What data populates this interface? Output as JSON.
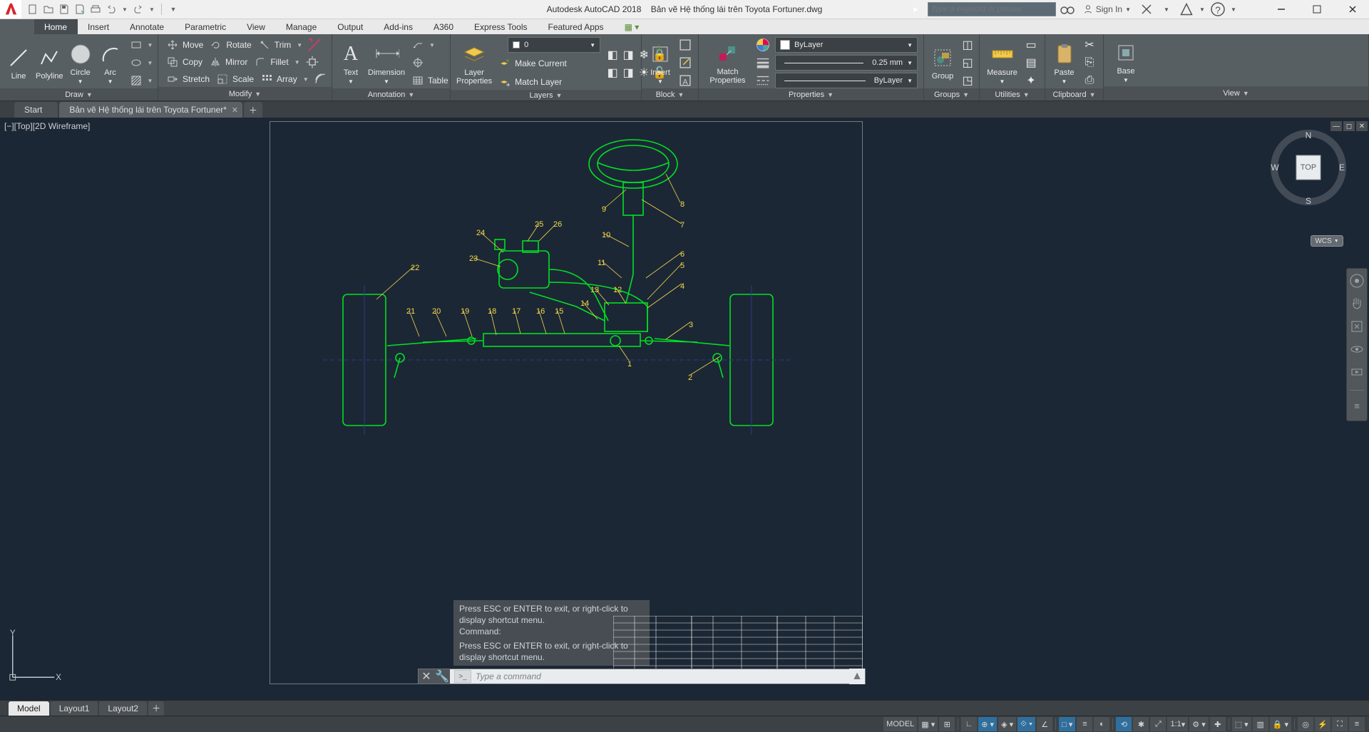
{
  "app": {
    "name": "Autodesk AutoCAD 2018",
    "document": "Bản vẽ Hệ thống lái trên Toyota Fortuner.dwg"
  },
  "search": {
    "placeholder": "Type a keyword or phrase"
  },
  "signin": {
    "label": "Sign In"
  },
  "ribbon_tabs": [
    "Home",
    "Insert",
    "Annotate",
    "Parametric",
    "View",
    "Manage",
    "Output",
    "Add-ins",
    "A360",
    "Express Tools",
    "Featured Apps"
  ],
  "ribbon_active_tab": "Home",
  "panels": {
    "draw": {
      "title": "Draw",
      "tools": {
        "line": "Line",
        "polyline": "Polyline",
        "circle": "Circle",
        "arc": "Arc"
      }
    },
    "modify": {
      "title": "Modify",
      "tools": {
        "move": "Move",
        "rotate": "Rotate",
        "trim": "Trim",
        "copy": "Copy",
        "mirror": "Mirror",
        "fillet": "Fillet",
        "stretch": "Stretch",
        "scale": "Scale",
        "array": "Array"
      }
    },
    "annotation": {
      "title": "Annotation",
      "tools": {
        "text": "Text",
        "dimension": "Dimension",
        "table": "Table"
      }
    },
    "layers": {
      "title": "Layers",
      "tools": {
        "layerprops": "Layer\nProperties",
        "makecurrent": "Make Current",
        "matchlayer": "Match Layer"
      },
      "current_layer": "0"
    },
    "block": {
      "title": "Block",
      "tools": {
        "insert": "Insert"
      }
    },
    "properties": {
      "title": "Properties",
      "tools": {
        "matchprops": "Match\nProperties"
      },
      "color": "ByLayer",
      "lineweight": "0.25 mm",
      "linetype": "ByLayer"
    },
    "groups": {
      "title": "Groups",
      "tools": {
        "group": "Group"
      }
    },
    "utilities": {
      "title": "Utilities",
      "tools": {
        "measure": "Measure"
      }
    },
    "clipboard": {
      "title": "Clipboard",
      "tools": {
        "paste": "Paste"
      }
    },
    "view": {
      "title": "View",
      "tools": {
        "base": "Base"
      }
    }
  },
  "file_tabs": {
    "start": "Start",
    "doc": "Bản vẽ Hệ thống lái trên Toyota Fortuner*"
  },
  "viewport_label": "[−][Top][2D Wireframe]",
  "viewcube": {
    "face": "TOP",
    "n": "N",
    "s": "S",
    "e": "E",
    "w": "W"
  },
  "wcs_badge": "WCS",
  "ucs": {
    "x": "X",
    "y": "Y"
  },
  "drawing_labels": [
    "1",
    "2",
    "3",
    "4",
    "5",
    "6",
    "7",
    "8",
    "9",
    "10",
    "11",
    "12",
    "13",
    "14",
    "15",
    "16",
    "17",
    "18",
    "19",
    "20",
    "21",
    "22",
    "23",
    "24",
    "25",
    "26"
  ],
  "command": {
    "hist1": "Press ESC or ENTER to exit, or right-click to display shortcut menu.",
    "hist2": "Command:",
    "hist3": "Press ESC or ENTER to exit, or right-click to display shortcut menu.",
    "placeholder": "Type a command"
  },
  "layout_tabs": {
    "model": "Model",
    "l1": "Layout1",
    "l2": "Layout2"
  },
  "status": {
    "model": "MODEL",
    "scale": "1:1"
  }
}
